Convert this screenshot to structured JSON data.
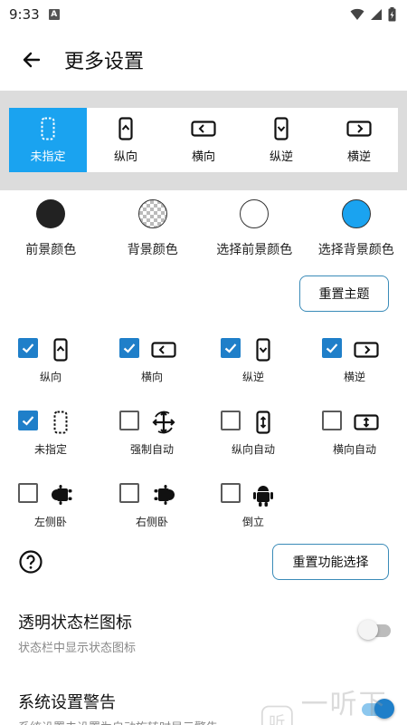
{
  "status_bar": {
    "time": "9:33",
    "notif_badge": "A"
  },
  "app_bar": {
    "title": "更多设置",
    "back_icon": "arrow-left-icon"
  },
  "modes": {
    "items": [
      {
        "id": "unspecified",
        "label": "未指定",
        "icon": "dotted-phone-icon",
        "active": true
      },
      {
        "id": "portrait",
        "label": "纵向",
        "icon": "portrait-phone-icon",
        "active": false
      },
      {
        "id": "landscape",
        "label": "横向",
        "icon": "landscape-phone-icon",
        "active": false
      },
      {
        "id": "reverse-portrait",
        "label": "纵逆",
        "icon": "reverse-portrait-phone-icon",
        "active": false
      },
      {
        "id": "reverse-landscape",
        "label": "横逆",
        "icon": "reverse-landscape-phone-icon",
        "active": false
      }
    ],
    "active_color": "#1aa3f0"
  },
  "colors": {
    "items": [
      {
        "label": "前景颜色",
        "swatch": "#222222"
      },
      {
        "label": "背景颜色",
        "swatch": "transparent-checker"
      },
      {
        "label": "选择前景颜色",
        "swatch": "#ffffff"
      },
      {
        "label": "选择背景颜色",
        "swatch": "#1aa3f0"
      }
    ],
    "reset_theme_label": "重置主题"
  },
  "options": {
    "items": [
      {
        "label": "纵向",
        "checked": true,
        "icon": "portrait-phone-icon"
      },
      {
        "label": "横向",
        "checked": true,
        "icon": "landscape-phone-icon"
      },
      {
        "label": "纵逆",
        "checked": true,
        "icon": "reverse-portrait-phone-icon"
      },
      {
        "label": "横逆",
        "checked": true,
        "icon": "reverse-landscape-phone-icon"
      },
      {
        "label": "未指定",
        "checked": true,
        "icon": "dotted-phone-icon"
      },
      {
        "label": "强制自动",
        "checked": false,
        "icon": "force-rotate-icon"
      },
      {
        "label": "纵向自动",
        "checked": false,
        "icon": "portrait-auto-icon"
      },
      {
        "label": "横向自动",
        "checked": false,
        "icon": "landscape-auto-icon"
      },
      {
        "label": "左侧卧",
        "checked": false,
        "icon": "android-left-icon"
      },
      {
        "label": "右侧卧",
        "checked": false,
        "icon": "android-right-icon"
      },
      {
        "label": "倒立",
        "checked": false,
        "icon": "android-upright-icon"
      }
    ],
    "checked_color": "#1f7fc9",
    "reset_function_label": "重置功能选择"
  },
  "settings": [
    {
      "title": "透明状态栏图标",
      "subtitle": "状态栏中显示状态图标",
      "enabled": false
    },
    {
      "title": "系统设置警告",
      "subtitle": "系统设置未设置为自动旋转时显示警告",
      "enabled": true
    }
  ],
  "watermark": {
    "text": "一听下载"
  }
}
